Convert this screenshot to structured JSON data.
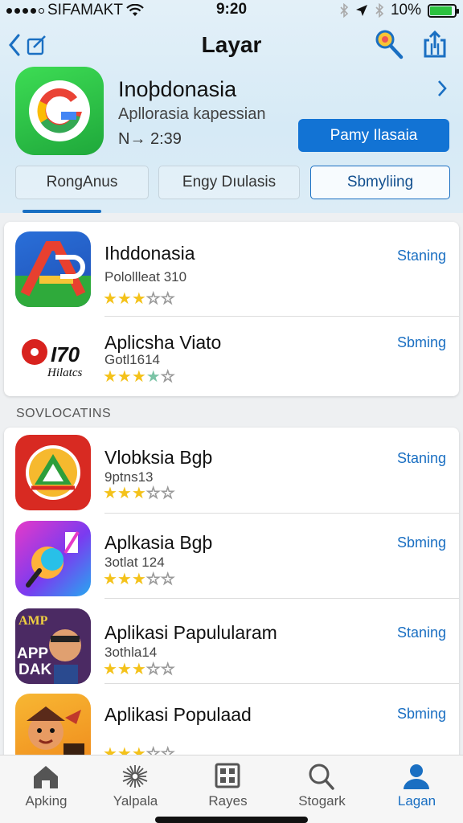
{
  "status_bar": {
    "carrier": "SIFAMAKT",
    "time": "9:20",
    "battery": "10%",
    "battery_level": 0.9
  },
  "nav": {
    "title": "Layar",
    "back_icon": "chevron-left-icon",
    "edit_icon": "edit-icon",
    "search_icon": "magnifier-icon",
    "share_icon": "share-icon"
  },
  "featured": {
    "name": "Inoþdonasia",
    "subtitle": "Apllorasia kapessian",
    "meta": "N→ 2:39",
    "button_label": "Pamy Ilasaia"
  },
  "segments": [
    "RongAnus",
    "Engy Dıulasis",
    "Sbmyliing"
  ],
  "top_list": [
    {
      "name": "Ihddonasia",
      "sub": "Polollleat 310",
      "stars": 3,
      "action": "Staning"
    },
    {
      "name": "Aplicsha Viato",
      "sub": "Gotl1614",
      "stars": 3.5,
      "action": "Sbming",
      "icon_text_1": "I70",
      "icon_text_2": "Hilatcs"
    }
  ],
  "section_label": "SOVLOCATINS",
  "section_list": [
    {
      "name": "Vlobksia Bgþ",
      "sub": "9ptns13",
      "stars": 3,
      "action": "Staning"
    },
    {
      "name": "Aplkasia Bgþ",
      "sub": "3otlat 124",
      "stars": 3,
      "action": "Sbming"
    },
    {
      "name": "Aplikasi Papulularam",
      "sub": "3othla14",
      "stars": 3,
      "action": "Staning",
      "icon_text_1": "AMP",
      "icon_text_2": "APP",
      "icon_text_3": "DAK"
    },
    {
      "name": "Aplikasi  Populaad",
      "sub": "",
      "stars": 3,
      "action": "Sbming"
    }
  ],
  "tabs": [
    {
      "label": "Apking",
      "icon": "home-icon"
    },
    {
      "label": "Yalpala",
      "icon": "sparkle-icon"
    },
    {
      "label": "Rayes",
      "icon": "grid-icon"
    },
    {
      "label": "Stogark",
      "icon": "search-icon"
    },
    {
      "label": "Lagan",
      "icon": "person-icon",
      "active": true
    }
  ],
  "colors": {
    "accent": "#1273d4",
    "star": "#f4c21a",
    "battery": "#2cc23f"
  }
}
